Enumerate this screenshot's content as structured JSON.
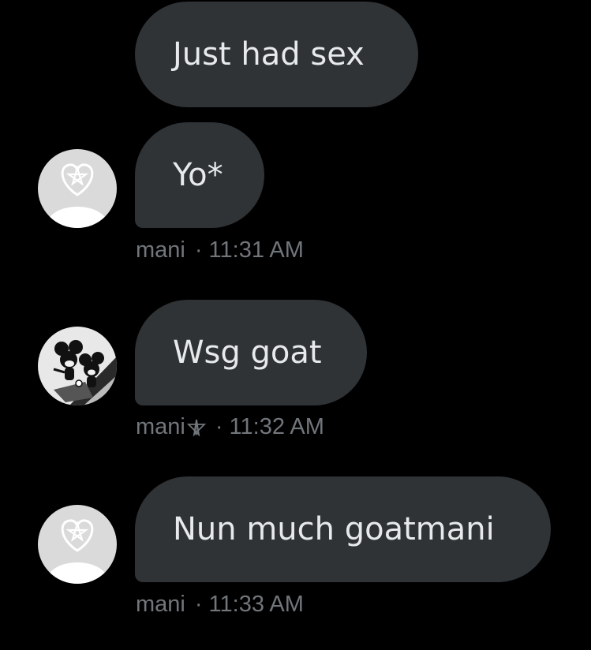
{
  "colors": {
    "background": "#000000",
    "bubble": "#2f3336",
    "message_text": "#e7e9ea",
    "meta_text": "#71767b"
  },
  "messages": [
    {
      "text": "Just had sex"
    },
    {
      "text": "Yo*",
      "avatar": "pentagram-heart-avatar",
      "sender": "mani",
      "separator": "·",
      "time": "11:31 AM"
    },
    {
      "text": "Wsg goat",
      "avatar": "cartoon-mouse-avatar",
      "sender": "mani",
      "sender_icon": "pentagram-star-icon",
      "separator": "·",
      "time": "11:32 AM"
    },
    {
      "text": "Nun much goatmani",
      "avatar": "pentagram-heart-avatar",
      "sender": "mani",
      "separator": "·",
      "time": "11:33 AM"
    }
  ]
}
